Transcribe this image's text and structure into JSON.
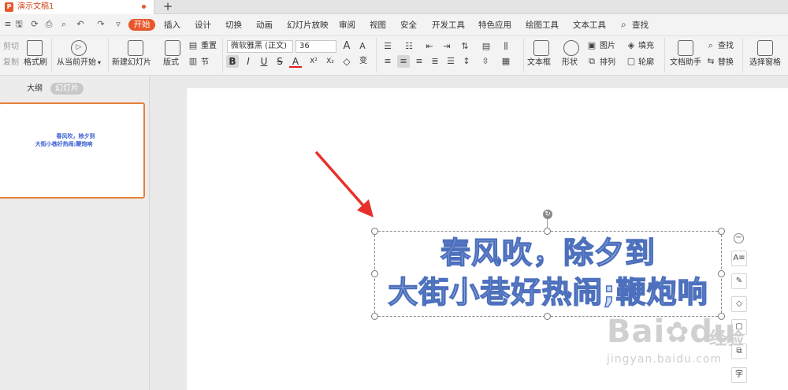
{
  "titlebar": {
    "doc_title": "演示文稿1",
    "new_tab": "+"
  },
  "quick_access": {
    "save": "🖫",
    "redo_alt": "⟳",
    "print": "⎙",
    "preview": "⌕",
    "undo": "↶",
    "redo": "↷",
    "more": "▿"
  },
  "menu": {
    "active": "开始",
    "items": [
      "插入",
      "设计",
      "切换",
      "动画",
      "幻灯片放映",
      "审阅",
      "视图",
      "安全",
      "开发工具",
      "特色应用",
      "绘图工具",
      "文本工具"
    ],
    "search": "查找"
  },
  "ribbon": {
    "cut": "剪切",
    "copy": "复制",
    "format_painter": "格式刷",
    "from_current": "从当前开始",
    "new_slide": "新建幻灯片",
    "layout": "版式",
    "section": "节",
    "reset": "重置",
    "font_name": "微软雅黑 (正文)",
    "font_size": "36",
    "text_box": "文本框",
    "shape": "形状",
    "picture": "图片",
    "fill": "填充",
    "arrange": "排列",
    "outline": "轮廓",
    "doc_helper": "文档助手",
    "find": "查找",
    "replace": "替换",
    "select_pane": "选择窗格",
    "fmt": {
      "bold": "B",
      "italic": "I",
      "underline": "U",
      "strike": "S",
      "fontcolor": "A",
      "superscript": "X²",
      "subscript": "X₂",
      "clear": "◇",
      "special": "变"
    }
  },
  "panel": {
    "tab_outline": "大纲",
    "tab_slides": "幻灯片"
  },
  "slide": {
    "line1": "春风吹，除夕到",
    "line2": "大街小巷好热闹;鞭炮响"
  },
  "watermark": {
    "brand": "Bai",
    "du": "du",
    "jingyan": "经验",
    "url": "jingyan.baidu.com"
  },
  "colors": {
    "accent": "#e8562a",
    "text_fill": "#cfdcf4",
    "text_outline": "#4d70bd",
    "arrow": "#e8302b"
  }
}
